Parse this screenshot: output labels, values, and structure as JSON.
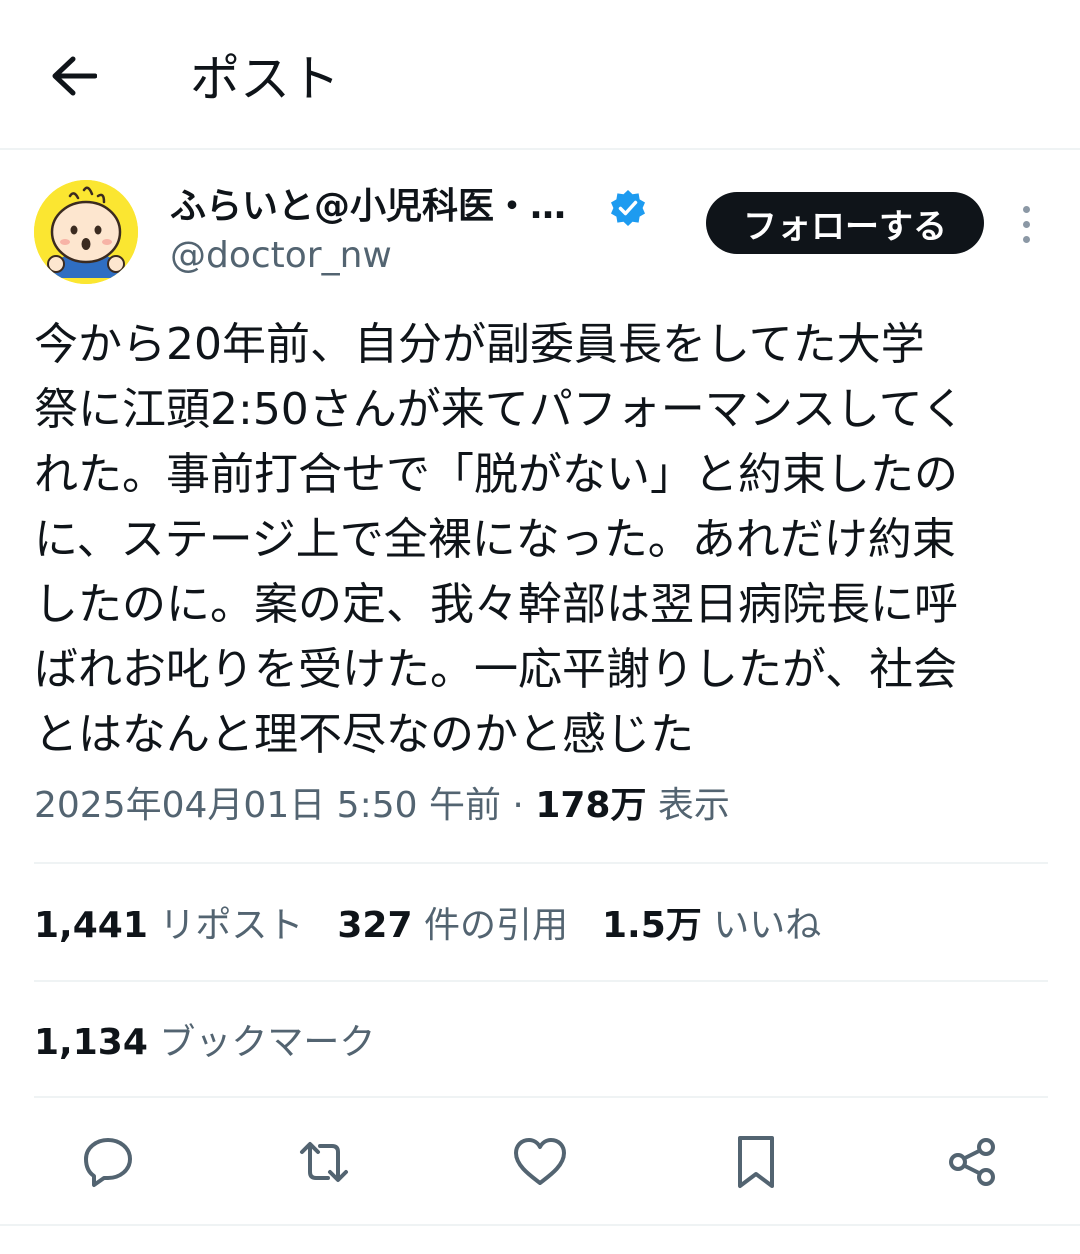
{
  "header": {
    "back_icon": "arrow-left-icon",
    "title": "ポスト"
  },
  "author": {
    "display_name": "ふらいと@小児科医・…",
    "handle": "@doctor_nw",
    "verified_icon": "verified-badge-icon",
    "verified_color": "#1d9bf0",
    "follow_label": "フォローする",
    "more_icon": "more-vertical-icon"
  },
  "post": {
    "text": "今から20年前、自分が副委員長をしてた大学\n祭に江頭2:50さんが来てパフォーマンスしてく\nれた。事前打合せで「脱がない」と約束したの\nに、ステージ上で全裸になった。あれだけ約束\nしたのに。案の定、我々幹部は翌日病院長に呼\nばれお叱りを受けた。一応平謝りしたが、社会\nとはなんと理不尽なのかと感じた"
  },
  "meta": {
    "timestamp": "2025年04月01日 5:50 午前",
    "separator": " · ",
    "views_count": "178万",
    "views_label": "表示"
  },
  "stats": {
    "reposts_count": "1,441",
    "reposts_label": "リポスト",
    "quotes_count": "327",
    "quotes_label": "件の引用",
    "likes_count": "1.5万",
    "likes_label": "いいね",
    "bookmarks_count": "1,134",
    "bookmarks_label": "ブックマーク"
  },
  "actions": {
    "reply_icon": "reply-icon",
    "repost_icon": "repost-icon",
    "like_icon": "heart-icon",
    "bookmark_icon": "bookmark-icon",
    "share_icon": "share-icon"
  },
  "colors": {
    "text": "#0f1419",
    "secondary": "#536471",
    "icon": "#536471",
    "divider": "#eff3f4",
    "avatar_bg": "#fbe631"
  }
}
